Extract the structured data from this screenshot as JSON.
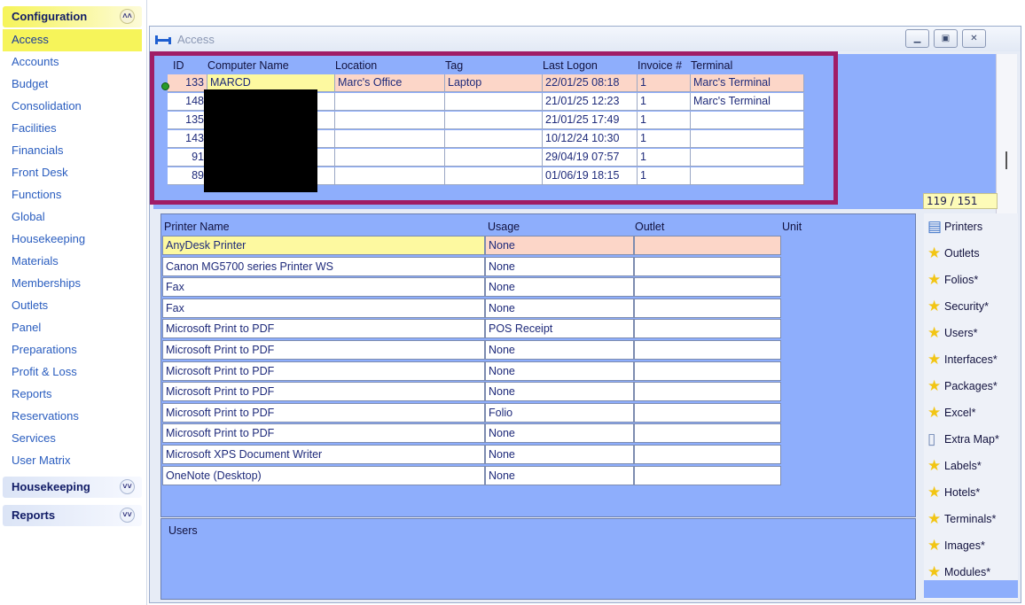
{
  "sidebar": {
    "sections": {
      "configuration": "Configuration",
      "housekeeping": "Housekeeping",
      "reports": "Reports"
    },
    "active_item": "Access",
    "items": [
      "Access",
      "Accounts",
      "Budget",
      "Consolidation",
      "Facilities",
      "Financials",
      "Front Desk",
      "Functions",
      "Global",
      "Housekeeping",
      "Materials",
      "Memberships",
      "Outlets",
      "Panel",
      "Preparations",
      "Profit & Loss",
      "Reports",
      "Reservations",
      "Services",
      "User Matrix"
    ]
  },
  "window": {
    "title": "Access"
  },
  "computers": {
    "headers": {
      "id": "ID",
      "name": "Computer Name",
      "location": "Location",
      "tag": "Tag",
      "last_logon": "Last Logon",
      "invoice": "Invoice #",
      "terminal": "Terminal"
    },
    "rows": [
      {
        "id": "133",
        "name": "MARCD",
        "location": "Marc's Office",
        "tag": "Laptop",
        "last_logon": "22/01/25 08:18",
        "invoice": "1",
        "terminal": "Marc's Terminal"
      },
      {
        "id": "148",
        "name": "",
        "location": "",
        "tag": "",
        "last_logon": "21/01/25 12:23",
        "invoice": "1",
        "terminal": "Marc's Terminal"
      },
      {
        "id": "135",
        "name": "",
        "location": "",
        "tag": "",
        "last_logon": "21/01/25 17:49",
        "invoice": "1",
        "terminal": ""
      },
      {
        "id": "143",
        "name": "",
        "location": "",
        "tag": "",
        "last_logon": "10/12/24 10:30",
        "invoice": "1",
        "terminal": ""
      },
      {
        "id": "91",
        "name": "",
        "location": "",
        "tag": "",
        "last_logon": "29/04/19 07:57",
        "invoice": "1",
        "terminal": ""
      },
      {
        "id": "89",
        "name": "",
        "location": "",
        "tag": "",
        "last_logon": "01/06/19 18:15",
        "invoice": "1",
        "terminal": ""
      }
    ],
    "counter": "119 / 151"
  },
  "printers": {
    "headers": {
      "name": "Printer Name",
      "usage": "Usage",
      "outlet": "Outlet",
      "unit": "Unit"
    },
    "rows": [
      {
        "name": "AnyDesk Printer",
        "usage": "None"
      },
      {
        "name": "Canon MG5700 series Printer WS",
        "usage": "None"
      },
      {
        "name": "Fax",
        "usage": "None"
      },
      {
        "name": "Fax",
        "usage": "None"
      },
      {
        "name": "Microsoft Print to PDF",
        "usage": "POS Receipt"
      },
      {
        "name": "Microsoft Print to PDF",
        "usage": "None"
      },
      {
        "name": "Microsoft Print to PDF",
        "usage": "None"
      },
      {
        "name": "Microsoft Print to PDF",
        "usage": "None"
      },
      {
        "name": "Microsoft Print to PDF",
        "usage": "Folio"
      },
      {
        "name": "Microsoft Print to PDF",
        "usage": "None"
      },
      {
        "name": "Microsoft XPS Document Writer",
        "usage": "None"
      },
      {
        "name": "OneNote (Desktop)",
        "usage": "None"
      }
    ]
  },
  "users": {
    "label": "Users"
  },
  "side_buttons": [
    {
      "label": "Printers",
      "icon": "printer-icon"
    },
    {
      "label": "Outlets",
      "icon": "star-icon"
    },
    {
      "label": "Folios*",
      "icon": "star-icon"
    },
    {
      "label": "Security*",
      "icon": "star-icon"
    },
    {
      "label": "Users*",
      "icon": "star-icon"
    },
    {
      "label": "Interfaces*",
      "icon": "star-icon"
    },
    {
      "label": "Packages*",
      "icon": "star-icon"
    },
    {
      "label": "Excel*",
      "icon": "star-icon"
    },
    {
      "label": "Extra Map*",
      "icon": "document-icon"
    },
    {
      "label": "Labels*",
      "icon": "star-icon"
    },
    {
      "label": "Hotels*",
      "icon": "star-icon"
    },
    {
      "label": "Terminals*",
      "icon": "star-icon"
    },
    {
      "label": "Images*",
      "icon": "star-icon"
    },
    {
      "label": "Modules*",
      "icon": "star-icon"
    }
  ],
  "colors": {
    "highlight_border": "#a01d66",
    "panel_blue": "#8eaefc",
    "selected_row": "#fcd6c8",
    "selected_name": "#fdf9a0",
    "nav_active": "#f6f45a"
  }
}
